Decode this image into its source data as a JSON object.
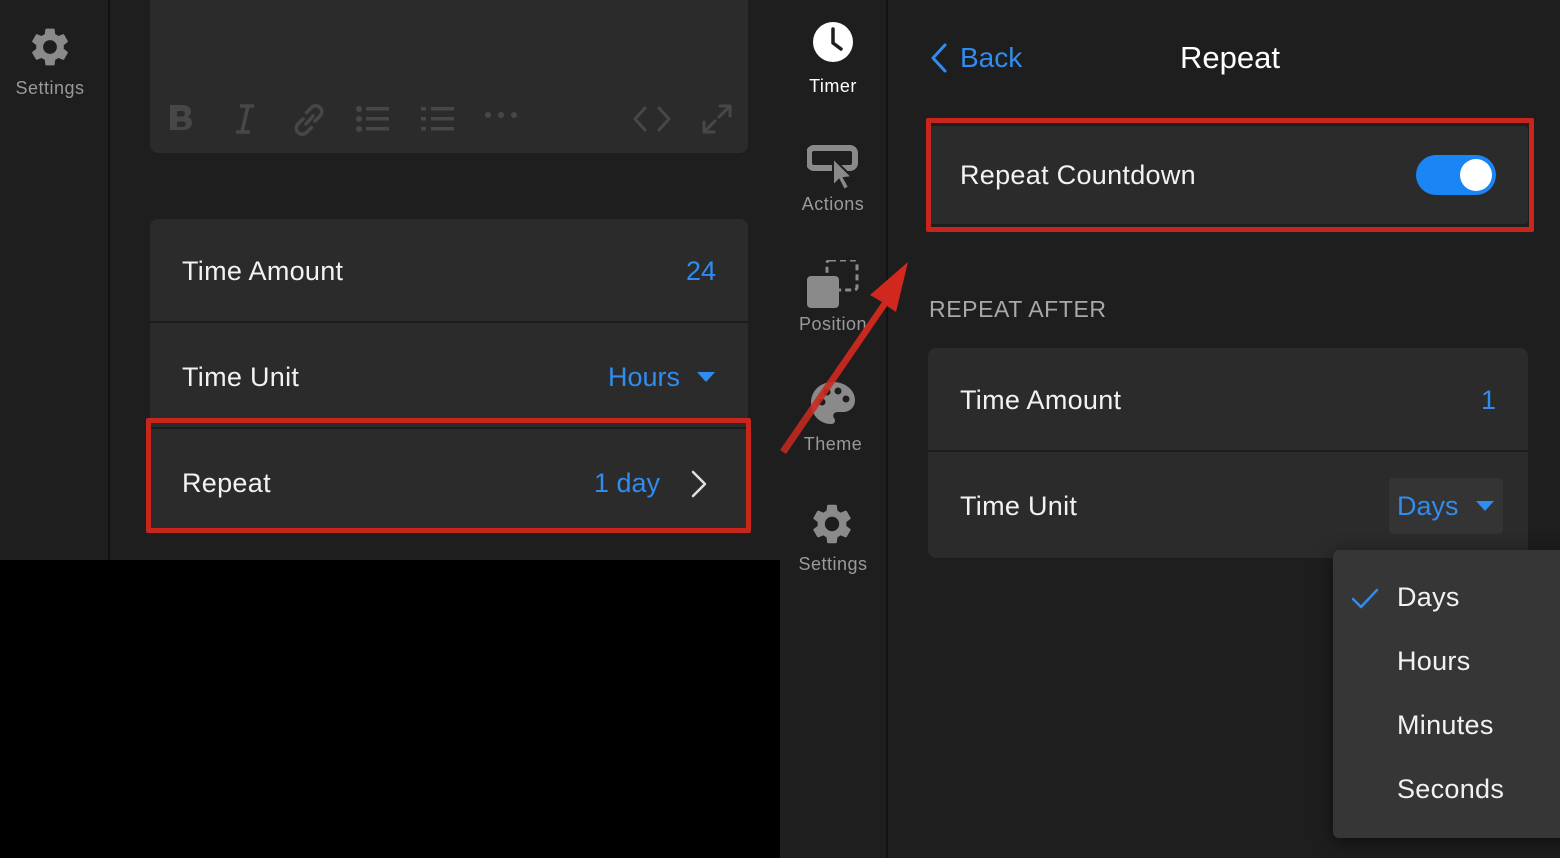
{
  "left_rail": {
    "settings_label": "Settings"
  },
  "editor_toolbar": {
    "icons": [
      "bold-icon",
      "italic-icon",
      "link-icon",
      "bulleted-list-icon",
      "numbered-list-icon",
      "more-icon",
      "code-icon",
      "expand-icon"
    ]
  },
  "left_settings": {
    "time_amount": {
      "label": "Time Amount",
      "value": "24"
    },
    "time_unit": {
      "label": "Time Unit",
      "value": "Hours"
    },
    "repeat": {
      "label": "Repeat",
      "value": "1 day"
    }
  },
  "tabs": [
    {
      "label": "Timer",
      "icon": "clock-icon",
      "active": true
    },
    {
      "label": "Actions",
      "icon": "cursor-click-icon",
      "active": false
    },
    {
      "label": "Position",
      "icon": "position-icon",
      "active": false
    },
    {
      "label": "Theme",
      "icon": "palette-icon",
      "active": false
    },
    {
      "label": "Settings",
      "icon": "gear-icon",
      "active": false
    }
  ],
  "repeat_page": {
    "back_label": "Back",
    "title": "Repeat",
    "repeat_countdown": {
      "label": "Repeat Countdown",
      "enabled": true
    },
    "section_header": "REPEAT AFTER",
    "time_amount": {
      "label": "Time Amount",
      "value": "1"
    },
    "time_unit": {
      "label": "Time Unit",
      "value": "Days"
    }
  },
  "time_unit_menu": {
    "options": [
      "Days",
      "Hours",
      "Minutes",
      "Seconds"
    ],
    "selected": "Days"
  },
  "colors": {
    "accent": "#2f8cf0",
    "toggle_on": "#1a86f5",
    "highlight": "#c8261c",
    "background": "#1e1e1e",
    "card": "#2b2b2b"
  }
}
